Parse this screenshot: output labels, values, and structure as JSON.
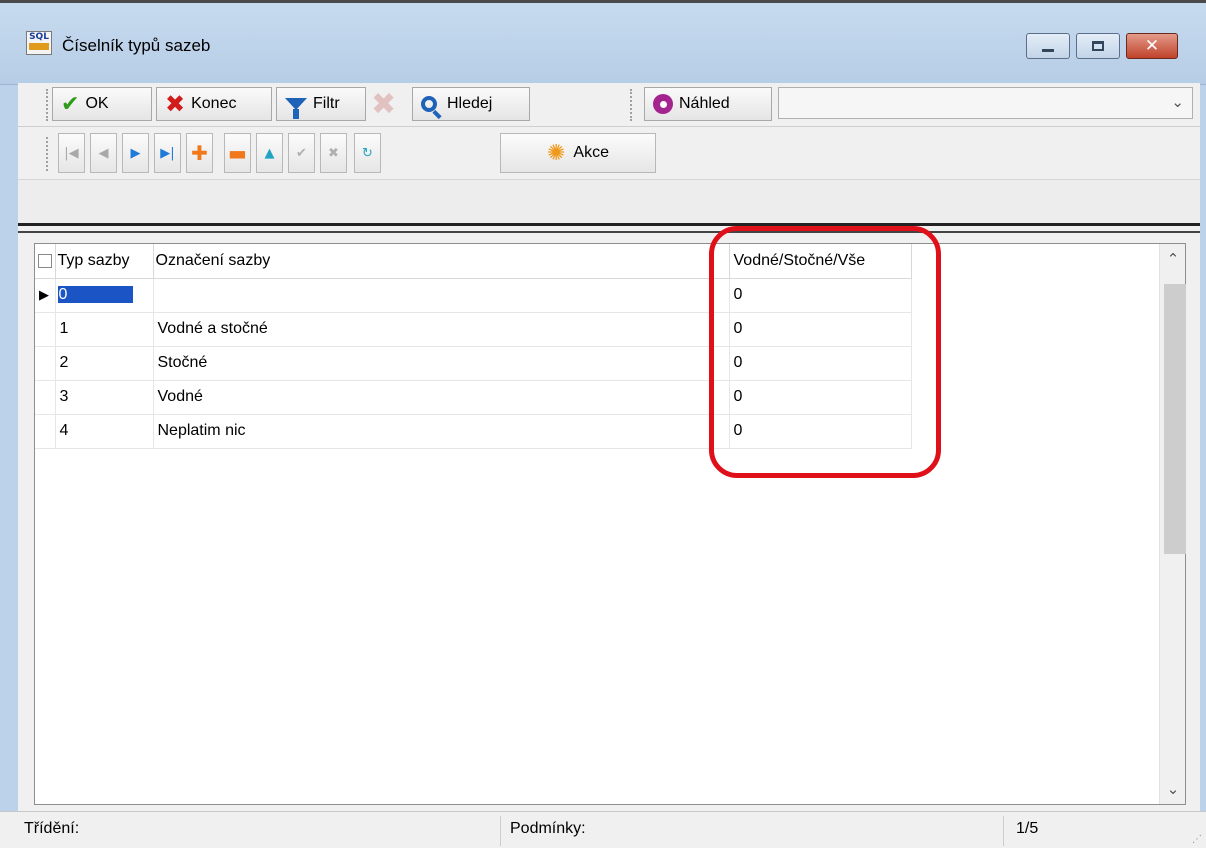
{
  "window": {
    "title": "Číselník typů sazeb",
    "icon_text": "SQL"
  },
  "toolbar": {
    "ok_label": "OK",
    "konec_label": "Konec",
    "filtr_label": "Filtr",
    "hledej_label": "Hledej",
    "nahled_label": "Náhled",
    "view_select_value": "",
    "akce_label": "Akce"
  },
  "grid": {
    "columns": [
      "Typ sazby",
      "Označení sazby",
      "Vodné/Stočné/Vše"
    ],
    "rows": [
      {
        "typ": "0",
        "oznaceni": "",
        "vodne": "0"
      },
      {
        "typ": "1",
        "oznaceni": "Vodné a stočné",
        "vodne": "0"
      },
      {
        "typ": "2",
        "oznaceni": "Stočné",
        "vodne": "0"
      },
      {
        "typ": "3",
        "oznaceni": "Vodné",
        "vodne": "0"
      },
      {
        "typ": "4",
        "oznaceni": "Neplatim nic",
        "vodne": "0"
      }
    ],
    "current_row_indicator": "▶"
  },
  "statusbar": {
    "sort_label": "Třídění:",
    "conditions_label": "Podmínky:",
    "record_position": "1/5"
  },
  "colors": {
    "highlight": "#e0101a",
    "selection": "#1b55c5"
  }
}
